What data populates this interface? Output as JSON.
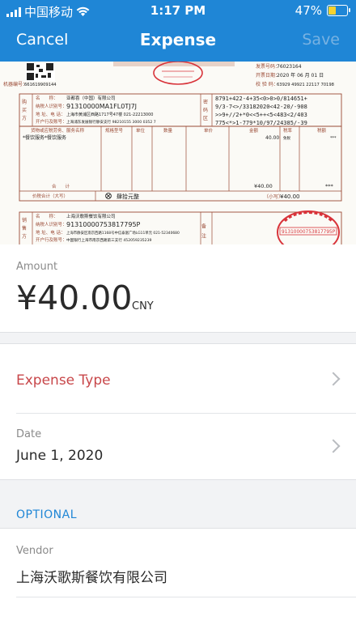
{
  "status_bar": {
    "carrier": "中国移动",
    "time": "1:17 PM",
    "battery_percent": "47%",
    "battery_level": 0.47
  },
  "nav": {
    "cancel_label": "Cancel",
    "title": "Expense",
    "save_label": "Save"
  },
  "receipt": {
    "invoice_code": "76023164",
    "issue_date": "2020 年 06 月 01 日",
    "check_code": "63929 49921 22117 70198",
    "machine_no": "661619909144",
    "buyer_name": "亚都喜（中国）有限公司",
    "buyer_tax_id": "91310000MA1FL0TJ7J",
    "buyer_address_phone": "上海市黄浦区西路1717号47楼 021-22213000",
    "buyer_bank_account": "上海浦东发展银行静安支行 98210155 3000 0352 7",
    "password_area": [
      "8791+422-4+35<0>0>0/814651+",
      "9/3-7<>/33182020<42-20/-908",
      ">>9+//2+*0<<5++<5<483<2/403",
      "775<*>1-779*10/97/24385/-39"
    ],
    "item_name": "*餐饮服务*餐饮服务",
    "item_amount": "40.00",
    "item_tax_rate": "免税",
    "item_tax": "***",
    "subtotal_label": "合　　计",
    "subtotal_amount": "¥40.00",
    "subtotal_tax": "***",
    "total_label": "价税合计（大写）",
    "total_chinese": "肆拾元整",
    "total_small_label": "（小写）",
    "total_small": "¥40.00",
    "seller_name": "上海沃歌斯餐饮有限公司",
    "seller_tax_id": "91310000753817795P",
    "seller_address_phone": "上海市静安区南京西路1168号中信泰富广场LG11单元 021-52340680",
    "seller_bank_account": "中国银行上海市南京西路第三支行 452059235239",
    "seller_stamp_id": "91310000753817795P",
    "note_label": "备　注"
  },
  "amount": {
    "label": "Amount",
    "value": "¥40.00",
    "currency": "CNY"
  },
  "expense_type": {
    "label": "Expense Type"
  },
  "date": {
    "label": "Date",
    "value": "June 1, 2020"
  },
  "optional": {
    "label": "OPTIONAL"
  },
  "vendor": {
    "label": "Vendor",
    "value": "上海沃歌斯餐饮有限公司"
  },
  "colors": {
    "header_blue": "#1f86d6",
    "save_disabled": "#78b2e2",
    "expense_type_red": "#c8474a",
    "invoice_brown": "#9a4a35",
    "stamp_red": "#d8333a"
  }
}
